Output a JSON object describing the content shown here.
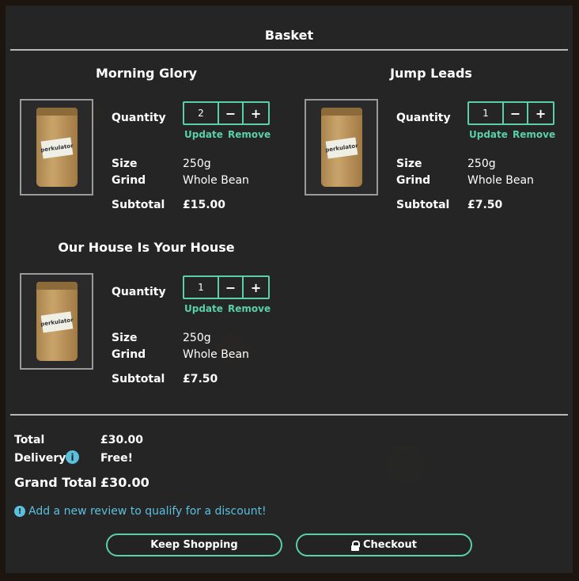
{
  "basket": {
    "title": "Basket"
  },
  "items": [
    {
      "name": "Morning Glory",
      "image_label": "perkulator",
      "quantity_label": "Quantity",
      "quantity": "2",
      "update_label": "Update",
      "remove_label": "Remove",
      "size_label": "Size",
      "size": "250g",
      "grind_label": "Grind",
      "grind": "Whole Bean",
      "subtotal_label": "Subtotal",
      "subtotal": "£15.00"
    },
    {
      "name": "Jump Leads",
      "image_label": "perkulator",
      "quantity_label": "Quantity",
      "quantity": "1",
      "update_label": "Update",
      "remove_label": "Remove",
      "size_label": "Size",
      "size": "250g",
      "grind_label": "Grind",
      "grind": "Whole Bean",
      "subtotal_label": "Subtotal",
      "subtotal": "£7.50"
    },
    {
      "name": "Our House Is Your House",
      "image_label": "perkulator",
      "quantity_label": "Quantity",
      "quantity": "1",
      "update_label": "Update",
      "remove_label": "Remove",
      "size_label": "Size",
      "size": "250g",
      "grind_label": "Grind",
      "grind": "Whole Bean",
      "subtotal_label": "Subtotal",
      "subtotal": "£7.50"
    }
  ],
  "totals": {
    "total_label": "Total",
    "total": "£30.00",
    "delivery_label": "Delivery",
    "delivery": "Free!",
    "grand_total_label": "Grand Total",
    "grand_total": "£30.00"
  },
  "review_notice": "Add a new review to qualify for a discount!",
  "buttons": {
    "keep_shopping": "Keep Shopping",
    "checkout": "Checkout"
  },
  "icons": {
    "minus": "−",
    "plus": "+",
    "info": "i",
    "alert": "!"
  },
  "colors": {
    "accent": "#5ad0a8",
    "info": "#5bc0de",
    "panel": "#262626"
  }
}
